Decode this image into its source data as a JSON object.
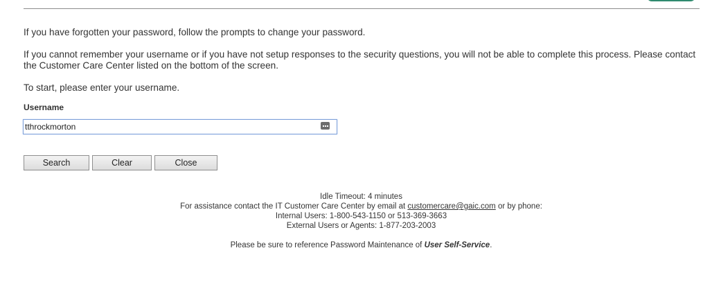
{
  "instructions": {
    "line1": "If you have forgotten your password, follow the prompts to change your password.",
    "line2": "If you cannot remember your username or if you have not setup responses to the security questions, you will not be able to complete this process.  Please contact the Customer Care Center listed on the bottom of the screen.",
    "line3": "To start, please enter your username."
  },
  "form": {
    "username_label": "Username",
    "username_value": "tthrockmorton"
  },
  "buttons": {
    "search": "Search",
    "clear": "Clear",
    "close": "Close"
  },
  "footer": {
    "idle_timeout": "Idle Timeout: 4 minutes",
    "assist_prefix": "For assistance contact the IT Customer Care Center by email at",
    "email": "customercare@gaic.com",
    "assist_suffix": "or by phone:",
    "internal": "Internal Users: 1-800-543-1150 or 513-369-3663",
    "external": "External Users or Agents: 1-877-203-2003",
    "reference_prefix": "Please be sure to reference Password Maintenance of",
    "reference_app": "User Self-Service",
    "reference_suffix": "."
  },
  "colors": {
    "focus_border": "#7ea0d9",
    "header_pill": "#2f8a6e"
  }
}
